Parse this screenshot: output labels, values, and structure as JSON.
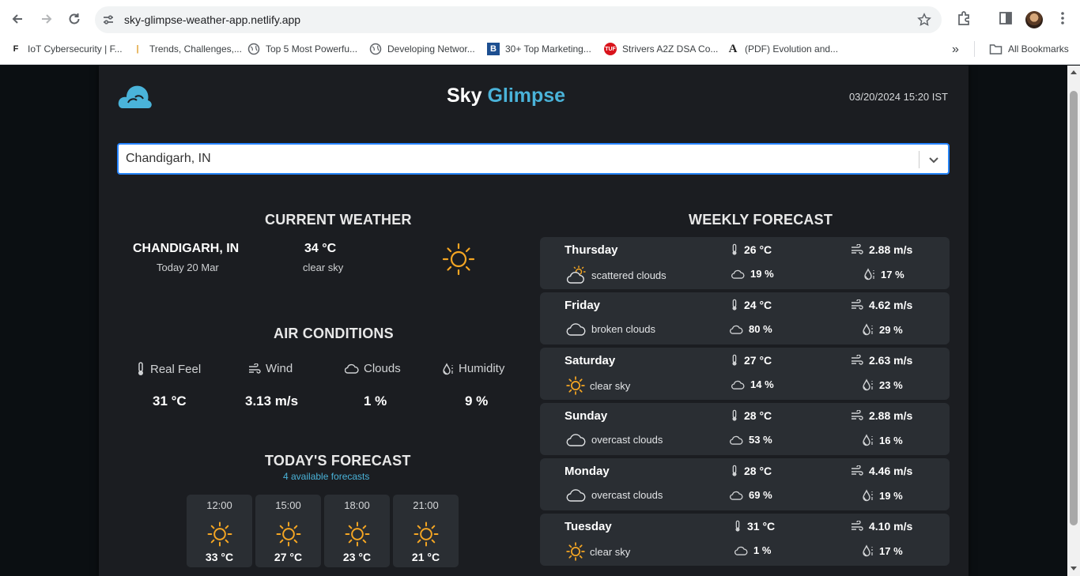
{
  "browser": {
    "url": "sky-glimpse-weather-app.netlify.app",
    "bookmarks": [
      "IoT Cybersecurity | F...",
      "Trends, Challenges,...",
      "Top 5 Most Powerfu...",
      "Developing Networ...",
      "30+ Top Marketing...",
      "Strivers A2Z DSA Co...",
      "(PDF) Evolution and..."
    ],
    "more_label": "»",
    "all_bookmarks": "All Bookmarks"
  },
  "app": {
    "brand_first": "Sky",
    "brand_second": "Glimpse",
    "datetime": "03/20/2024 15:20 IST",
    "search_value": "Chandigarh, IN",
    "accent_color": "#4ab3d9"
  },
  "current": {
    "title": "CURRENT WEATHER",
    "city": "CHANDIGARH, IN",
    "date": "Today 20 Mar",
    "temp": "34 °C",
    "desc": "clear sky",
    "icon": "sun-icon"
  },
  "air": {
    "title": "AIR CONDITIONS",
    "items": [
      {
        "label": "Real Feel",
        "value": "31 °C",
        "icon": "thermometer-icon"
      },
      {
        "label": "Wind",
        "value": "3.13 m/s",
        "icon": "wind-icon"
      },
      {
        "label": "Clouds",
        "value": "1 %",
        "icon": "cloud-icon"
      },
      {
        "label": "Humidity",
        "value": "9 %",
        "icon": "humidity-icon"
      }
    ]
  },
  "today": {
    "title": "TODAY'S FORECAST",
    "subtitle": "4 available forecasts",
    "hours": [
      {
        "time": "12:00",
        "temp": "33 °C",
        "icon": "sun-icon"
      },
      {
        "time": "15:00",
        "temp": "27 °C",
        "icon": "sun-icon"
      },
      {
        "time": "18:00",
        "temp": "23 °C",
        "icon": "sun-icon"
      },
      {
        "time": "21:00",
        "temp": "21 °C",
        "icon": "sun-icon"
      }
    ]
  },
  "weekly": {
    "title": "WEEKLY FORECAST",
    "days": [
      {
        "day": "Thursday",
        "desc": "scattered clouds",
        "icon": "partly-cloudy-icon",
        "temp": "26 °C",
        "wind": "2.88 m/s",
        "clouds": "19 %",
        "humidity": "17 %"
      },
      {
        "day": "Friday",
        "desc": "broken clouds",
        "icon": "cloud-icon",
        "temp": "24 °C",
        "wind": "4.62 m/s",
        "clouds": "80 %",
        "humidity": "29 %"
      },
      {
        "day": "Saturday",
        "desc": "clear sky",
        "icon": "sun-icon",
        "temp": "27 °C",
        "wind": "2.63 m/s",
        "clouds": "14 %",
        "humidity": "23 %"
      },
      {
        "day": "Sunday",
        "desc": "overcast clouds",
        "icon": "cloud-icon",
        "temp": "28 °C",
        "wind": "2.88 m/s",
        "clouds": "53 %",
        "humidity": "16 %"
      },
      {
        "day": "Monday",
        "desc": "overcast clouds",
        "icon": "cloud-icon",
        "temp": "28 °C",
        "wind": "4.46 m/s",
        "clouds": "69 %",
        "humidity": "19 %"
      },
      {
        "day": "Tuesday",
        "desc": "clear sky",
        "icon": "sun-icon",
        "temp": "31 °C",
        "wind": "4.10 m/s",
        "clouds": "1 %",
        "humidity": "17 %"
      }
    ]
  }
}
